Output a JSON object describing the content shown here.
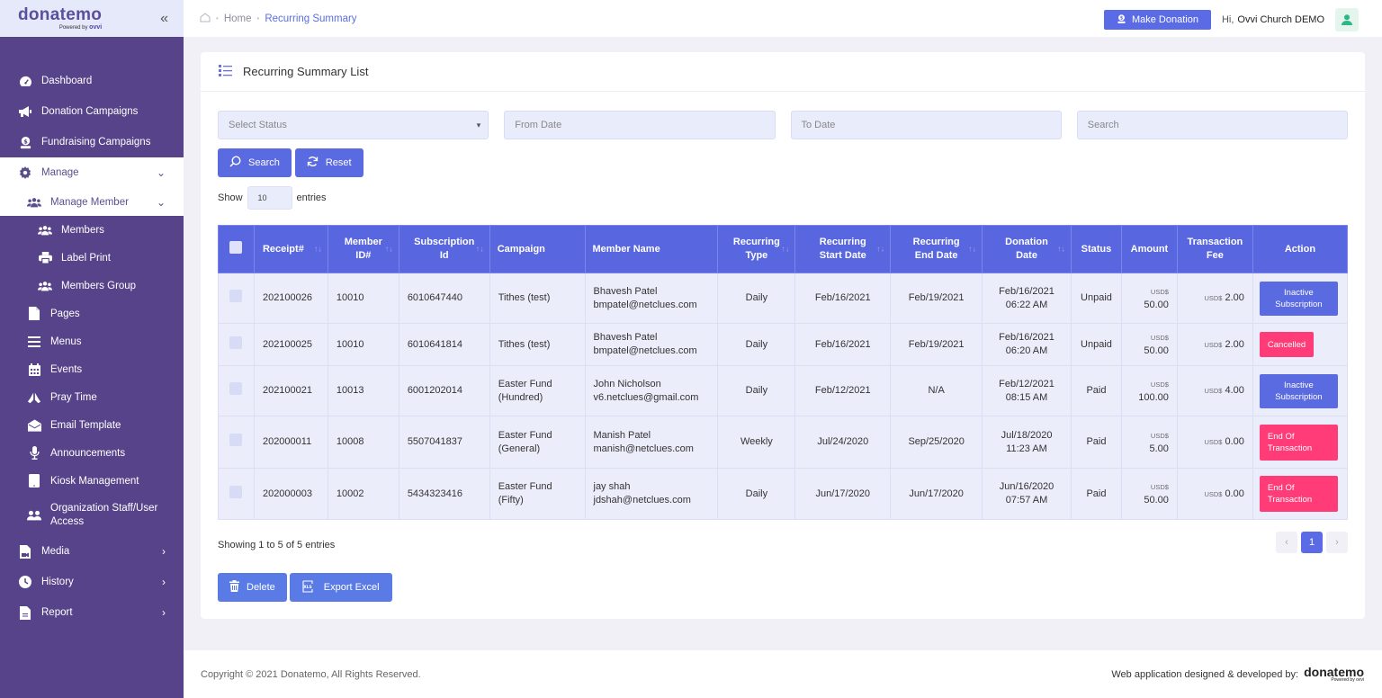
{
  "brand": {
    "name": "donatemo",
    "powered_by": "Powered by",
    "powered_brand": "ovvi"
  },
  "sidebar": {
    "items": [
      {
        "label": "Dashboard",
        "icon": "dashboard-icon"
      },
      {
        "label": "Donation Campaigns",
        "icon": "megaphone-icon"
      },
      {
        "label": "Fundraising Campaigns",
        "icon": "money-bag-icon"
      },
      {
        "label": "Manage",
        "icon": "gear-icon",
        "expanded": true
      },
      {
        "label": "Manage Member",
        "icon": "users-icon",
        "expanded": true
      },
      {
        "label": "Members",
        "icon": "users-icon"
      },
      {
        "label": "Label Print",
        "icon": "printer-icon"
      },
      {
        "label": "Members Group",
        "icon": "users-icon"
      },
      {
        "label": "Pages",
        "icon": "file-icon"
      },
      {
        "label": "Menus",
        "icon": "menu-icon"
      },
      {
        "label": "Events",
        "icon": "calendar-icon"
      },
      {
        "label": "Pray Time",
        "icon": "praying-hands-icon"
      },
      {
        "label": "Email Template",
        "icon": "envelope-open-icon"
      },
      {
        "label": "Announcements",
        "icon": "microphone-icon"
      },
      {
        "label": "Kiosk Management",
        "icon": "tablet-icon"
      },
      {
        "label": "Organization Staff/User Access",
        "icon": "user-friends-icon"
      },
      {
        "label": "Media",
        "icon": "file-video-icon"
      },
      {
        "label": "History",
        "icon": "clock-icon"
      },
      {
        "label": "Report",
        "icon": "file-alt-icon"
      }
    ]
  },
  "topbar": {
    "breadcrumb": [
      "Home",
      "Recurring Summary"
    ],
    "make_donation": "Make Donation",
    "greeting": "Hi,",
    "user_name": "Ovvi Church DEMO"
  },
  "card": {
    "title": "Recurring Summary List",
    "filters": {
      "status_placeholder": "Select Status",
      "from_date_placeholder": "From Date",
      "to_date_placeholder": "To Date",
      "search_placeholder": "Search"
    },
    "search_btn": "Search",
    "reset_btn": "Reset",
    "show_label": "Show",
    "show_value": "10",
    "entries_label": "entries"
  },
  "table": {
    "headers": [
      "Receipt#",
      "Member ID#",
      "Subscription Id",
      "Campaign",
      "Member Name",
      "Recurring Type",
      "Recurring Start Date",
      "Recurring End Date",
      "Donation Date",
      "Status",
      "Amount",
      "Transaction Fee",
      "Action"
    ],
    "rows": [
      {
        "receipt": "202100026",
        "member_id": "10010",
        "subscription_id": "6010647440",
        "campaign": "Tithes (test)",
        "member_name": "Bhavesh Patel",
        "member_email": "bmpatel@netclues.com",
        "type": "Daily",
        "start": "Feb/16/2021",
        "end": "Feb/19/2021",
        "donation_date": "Feb/16/2021",
        "donation_time": "06:22 AM",
        "status": "Unpaid",
        "currency": "USD$",
        "amount": "50.00",
        "fee": "2.00",
        "action": "Inactive Subscription"
      },
      {
        "receipt": "202100025",
        "member_id": "10010",
        "subscription_id": "6010641814",
        "campaign": "Tithes (test)",
        "member_name": "Bhavesh Patel",
        "member_email": "bmpatel@netclues.com",
        "type": "Daily",
        "start": "Feb/16/2021",
        "end": "Feb/19/2021",
        "donation_date": "Feb/16/2021",
        "donation_time": "06:20 AM",
        "status": "Unpaid",
        "currency": "USD$",
        "amount": "50.00",
        "fee": "2.00",
        "action": "Cancelled"
      },
      {
        "receipt": "202100021",
        "member_id": "10013",
        "subscription_id": "6001202014",
        "campaign": "Easter Fund (Hundred)",
        "member_name": "John Nicholson",
        "member_email": "v6.netclues@gmail.com",
        "type": "Daily",
        "start": "Feb/12/2021",
        "end": "N/A",
        "donation_date": "Feb/12/2021",
        "donation_time": "08:15 AM",
        "status": "Paid",
        "currency": "USD$",
        "amount": "100.00",
        "fee": "4.00",
        "action": "Inactive Subscription"
      },
      {
        "receipt": "202000011",
        "member_id": "10008",
        "subscription_id": "5507041837",
        "campaign": "Easter Fund (General)",
        "member_name": "Manish Patel",
        "member_email": "manish@netclues.com",
        "type": "Weekly",
        "start": "Jul/24/2020",
        "end": "Sep/25/2020",
        "donation_date": "Jul/18/2020",
        "donation_time": "11:23 AM",
        "status": "Paid",
        "currency": "USD$",
        "amount": "5.00",
        "fee": "0.00",
        "action": "End Of Transaction"
      },
      {
        "receipt": "202000003",
        "member_id": "10002",
        "subscription_id": "5434323416",
        "campaign": "Easter Fund (Fifty)",
        "member_name": "jay shah",
        "member_email": "jdshah@netclues.com",
        "type": "Daily",
        "start": "Jun/17/2020",
        "end": "Jun/17/2020",
        "donation_date": "Jun/16/2020",
        "donation_time": "07:57 AM",
        "status": "Paid",
        "currency": "USD$",
        "amount": "50.00",
        "fee": "0.00",
        "action": "End Of Transaction"
      }
    ]
  },
  "footer_table": {
    "showing": "Showing 1 to 5 of 5 entries",
    "page": "1",
    "prev": "‹",
    "next": "›",
    "delete_btn": "Delete",
    "export_btn": "Export Excel"
  },
  "footer": {
    "copyright": "Copyright © 2021 Donatemo, All Rights Reserved.",
    "developed_by": "Web application designed & developed by:",
    "dev_brand": "donatemo",
    "dev_powered": "Powered by ovvi"
  },
  "colors": {
    "primary": "#5866df",
    "sidebar": "#57438a",
    "danger": "#ff3b78",
    "paid": "#2db783",
    "unpaid": "#ee3b5e"
  }
}
